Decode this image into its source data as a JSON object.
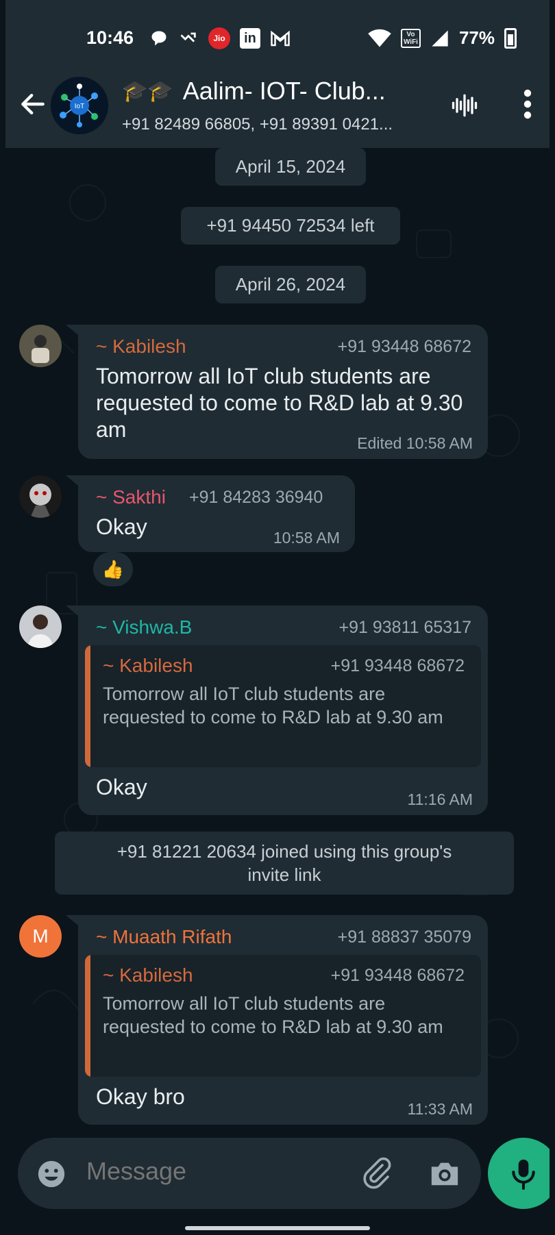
{
  "status_bar": {
    "time": "10:46",
    "battery": "77%",
    "carrier_badge": "Jio",
    "linkedin_badge": "in",
    "volte_badge": "Vo\nWiFi"
  },
  "header": {
    "title": "Aalim- IOT- Club...",
    "emoji_prefix": "🎓🎓",
    "subtitle": "+91 82489 66805, +91 89391 0421..."
  },
  "chat": {
    "date_1": "April 15, 2024",
    "system_left": "+91 94450 72534 left",
    "date_2": "April 26, 2024",
    "system_joined": "+91 81221 20634 joined using this group's invite link",
    "messages": [
      {
        "sender": "~ Kabilesh",
        "sender_color": "#d66a3d",
        "phone": "+91 93448 68672",
        "text": "Tomorrow all IoT club students are requested to come to R&D lab at 9.30 am",
        "time": "Edited 10:58 AM"
      },
      {
        "sender": "~ Sakthi",
        "sender_color": "#e8566d",
        "phone": "+91 84283 36940",
        "text": "Okay",
        "time": "10:58 AM",
        "reaction": "👍"
      },
      {
        "sender": "~ Vishwa.B",
        "sender_color": "#1fb7a6",
        "phone": "+91 93811 65317",
        "quote": {
          "sender": "~ Kabilesh",
          "phone": "+91 93448 68672",
          "text": "Tomorrow all IoT club students are requested to come to R&D lab at 9.30 am"
        },
        "text": "Okay",
        "time": "11:16 AM"
      },
      {
        "sender": "~ Muaath Rifath",
        "sender_color": "#f0733a",
        "phone": "+91 88837 35079",
        "avatar_letter": "M",
        "quote": {
          "sender": "~ Kabilesh",
          "phone": "+91 93448 68672",
          "text": "Tomorrow all IoT club students are requested to come to R&D lab at 9.30 am"
        },
        "text": "Okay bro",
        "time": "11:33 AM"
      }
    ]
  },
  "composer": {
    "placeholder": "Message"
  }
}
